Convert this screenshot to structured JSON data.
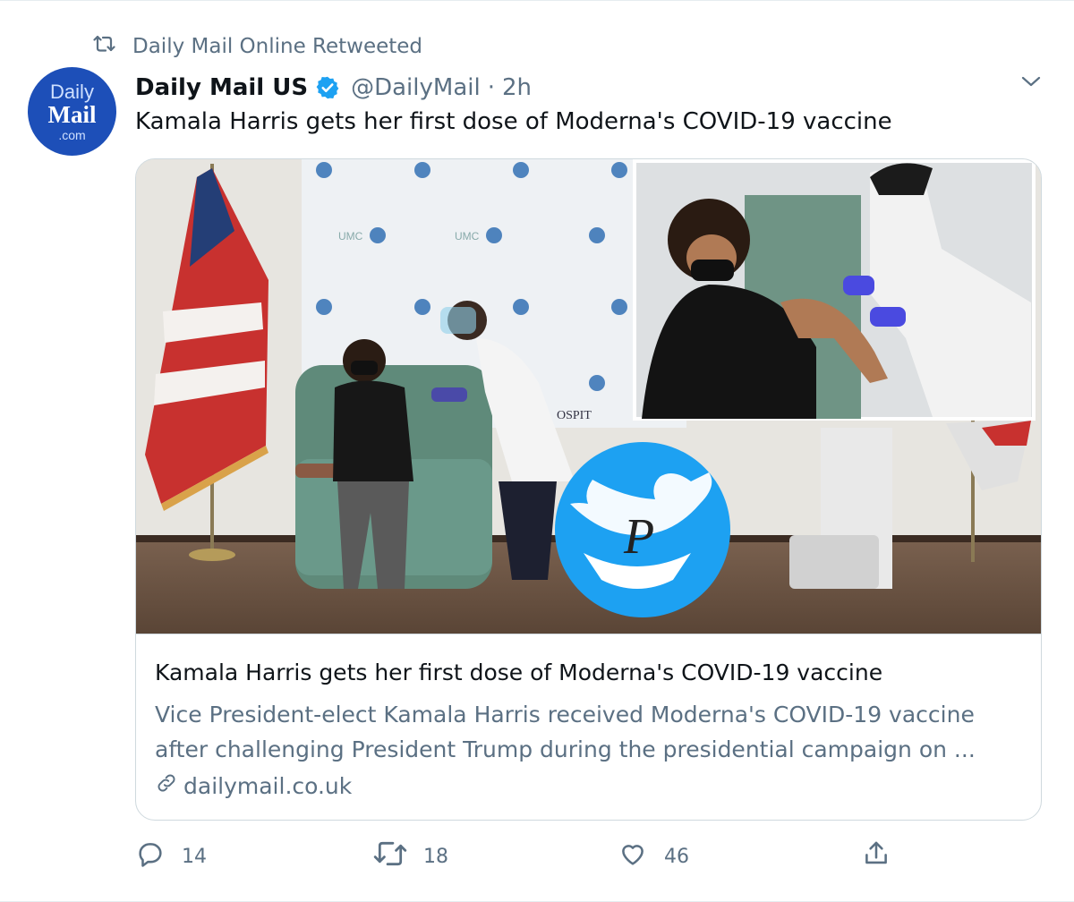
{
  "retweet_context": {
    "label": "Daily Mail Online Retweeted"
  },
  "author": {
    "avatar": {
      "line1": "Daily",
      "line2": "Mail",
      "line3": ".com"
    },
    "display_name": "Daily Mail US",
    "handle": "@DailyMail",
    "separator": "·",
    "time": "2h"
  },
  "tweet": {
    "text": "Kamala Harris gets her first dose of Moderna's COVID-19 vaccine"
  },
  "card": {
    "title": "Kamala Harris gets her first dose of Moderna's COVID-19 vaccine",
    "description_lines": [
      "Vice President-elect Kamala Harris received Moderna's COVID-19 vaccine",
      "after challenging President Trump during the presidential campaign on ..."
    ],
    "domain": "dailymail.co.uk",
    "photo_backdrop_labels": {
      "umc": "UMC",
      "hospital": "OSPIT"
    },
    "watermark_letter": "P"
  },
  "actions": {
    "replies": "14",
    "retweets": "18",
    "likes": "46"
  },
  "colors": {
    "accent": "#1da1f2",
    "muted_text": "#5b7083",
    "avatar_bg": "#1d4fb8",
    "border": "#cfd9de"
  },
  "icons": [
    "retweet-icon",
    "verified-badge-icon",
    "chevron-down-icon",
    "link-icon",
    "reply-icon",
    "like-icon",
    "share-icon"
  ]
}
